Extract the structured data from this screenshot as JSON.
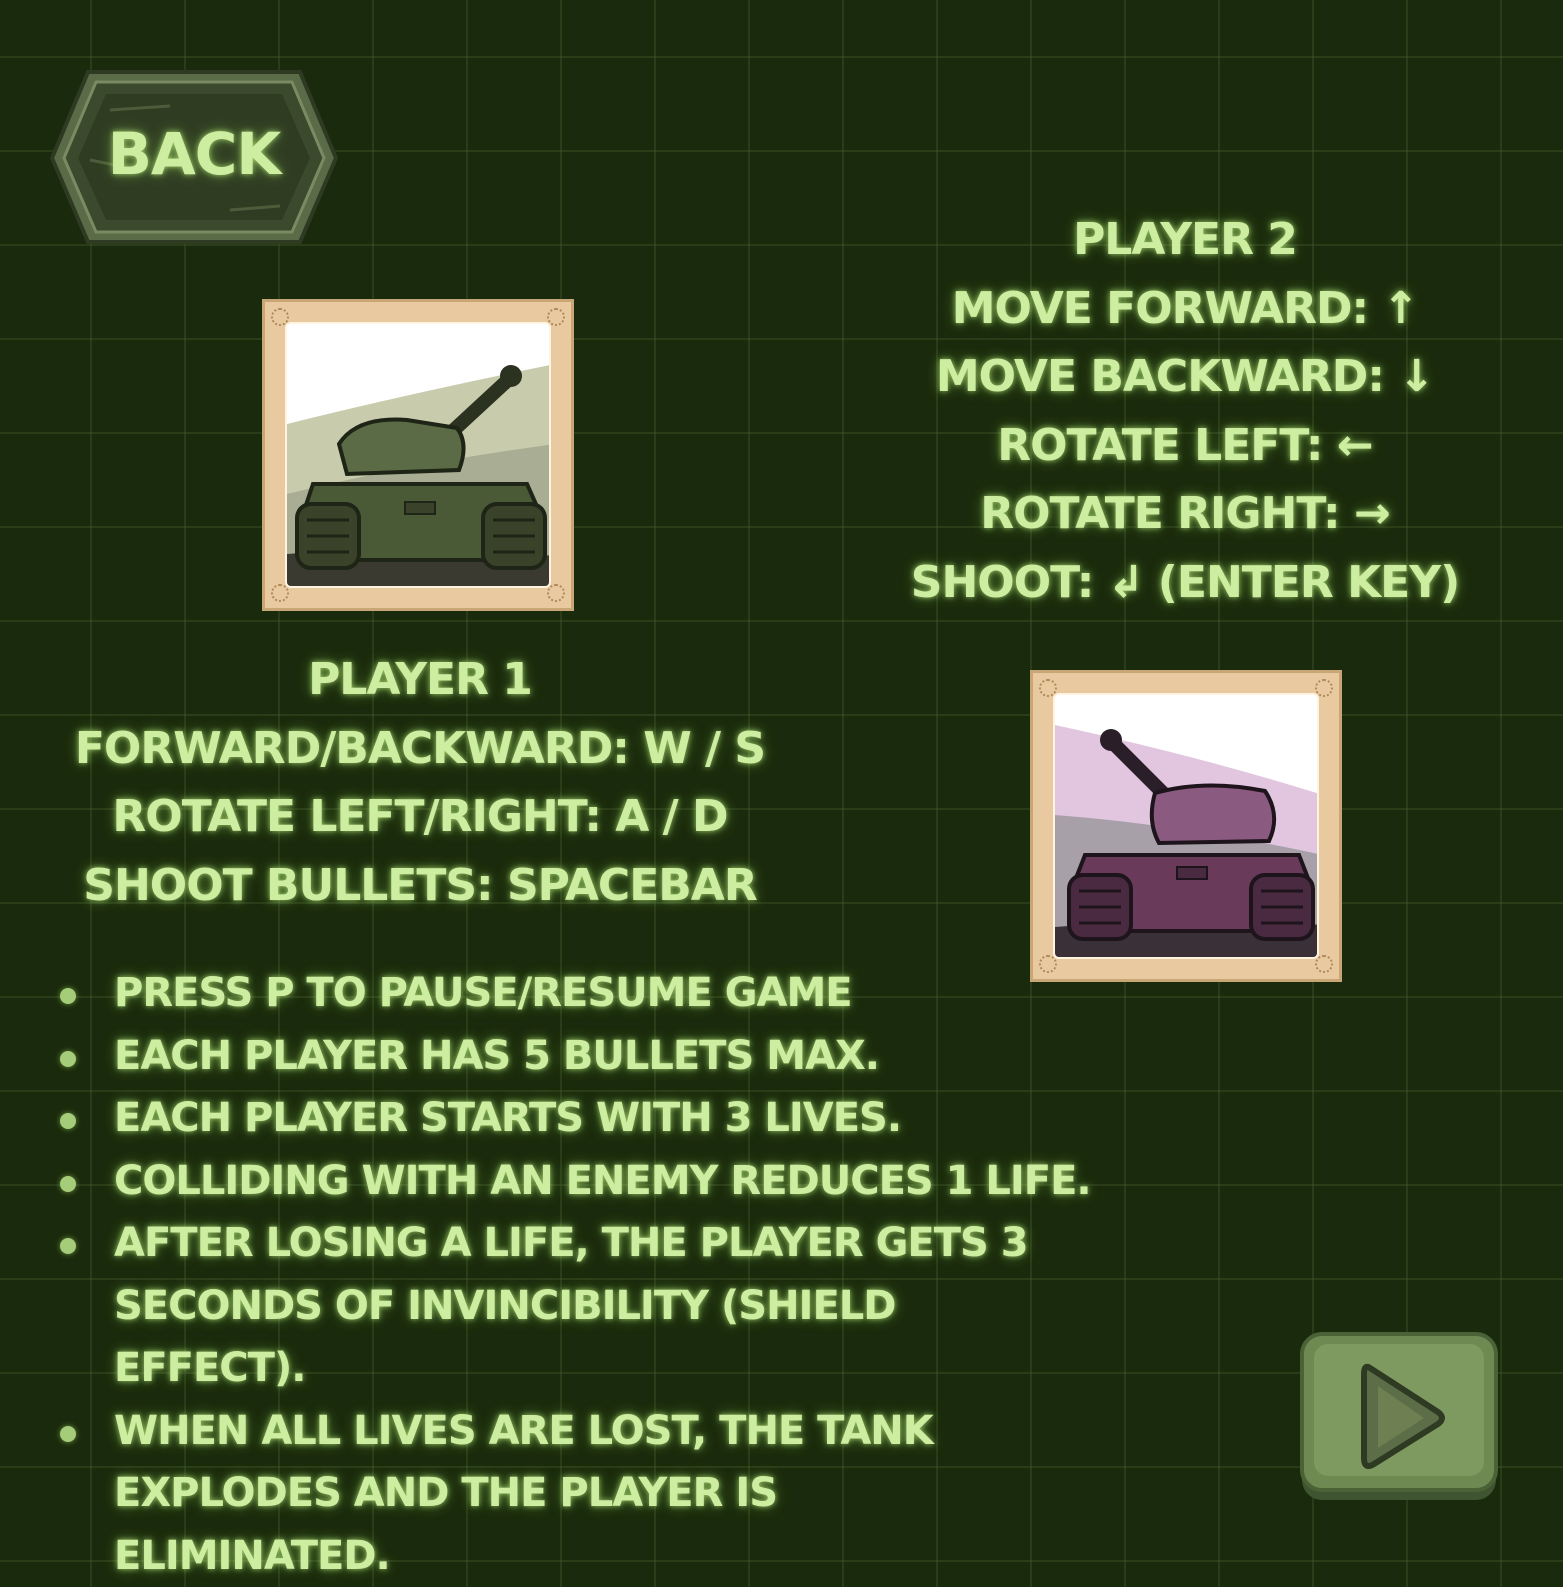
{
  "back_button": {
    "label": "BACK"
  },
  "player1": {
    "title": "PLAYER 1",
    "lines": [
      "FORWARD/BACKWARD: W / S",
      "ROTATE LEFT/RIGHT: A / D",
      "SHOOT BULLETS: SPACEBAR"
    ]
  },
  "player2": {
    "title": "PLAYER 2",
    "lines": [
      "MOVE FORWARD: ↑",
      "MOVE BACKWARD: ↓",
      "ROTATE LEFT: ←",
      "ROTATE RIGHT: →",
      "SHOOT: ↲ (ENTER KEY)"
    ]
  },
  "rules": [
    "PRESS P TO PAUSE/RESUME GAME",
    "EACH PLAYER HAS 5 BULLETS MAX.",
    "EACH PLAYER STARTS WITH 3 LIVES.",
    "COLLIDING WITH AN ENEMY REDUCES 1 LIFE.",
    "AFTER LOSING A LIFE, THE PLAYER GETS 3 SECONDS OF INVINCIBILITY (SHIELD EFFECT).",
    "WHEN ALL LIVES ARE LOST, THE TANK EXPLODES AND THE PLAYER IS ELIMINATED."
  ],
  "icons": {
    "back": "back-button-plate",
    "play": "play-icon",
    "tank1": "green-tank-image",
    "tank2": "purple-tank-image"
  },
  "colors": {
    "background": "#1a2a0c",
    "text": "#cdeea0",
    "tank1_tint": "#4a5a36",
    "tank2_tint": "#6a3a5a",
    "frame": "#e9caa0"
  }
}
